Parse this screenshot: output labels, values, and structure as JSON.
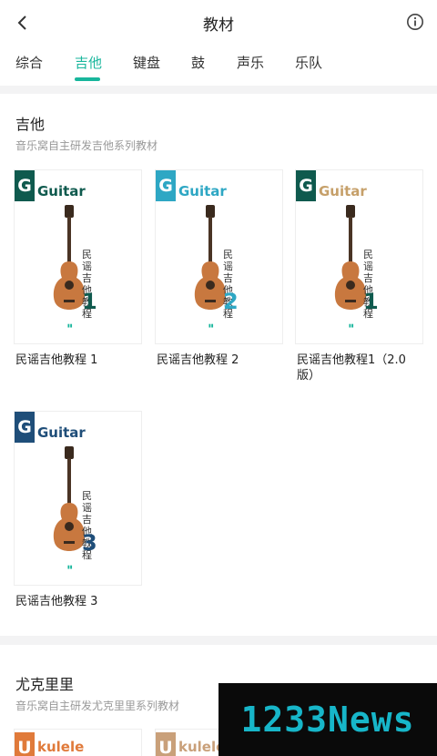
{
  "header": {
    "title": "教材"
  },
  "tabs": [
    "综合",
    "吉他",
    "键盘",
    "鼓",
    "声乐",
    "乐队"
  ],
  "guitar_section": {
    "title": "吉他",
    "subtitle": "音乐窝自主研发吉他系列教材",
    "books": [
      {
        "label": "民谣吉他教程 1",
        "brand": "Guitar",
        "badge": "G",
        "cover_text": "民谣吉他教程",
        "volume": "1",
        "badge_color": "#0f5a4e",
        "brand_color": "#0f5a4e",
        "volume_color": "#0f5a4e"
      },
      {
        "label": "民谣吉他教程 2",
        "brand": "Guitar",
        "badge": "G",
        "cover_text": "民谣吉他教程",
        "volume": "2",
        "badge_color": "#2ea7c4",
        "brand_color": "#2ea7c4",
        "volume_color": "#2ea7c4"
      },
      {
        "label": "民谣吉他教程1（2.0版）",
        "brand": "Guitar",
        "badge": "G",
        "cover_text": "民谣吉他教程",
        "volume": "1",
        "badge_color": "#0f5a4e",
        "brand_color": "#c6a06a",
        "volume_color": "#0f5a4e"
      },
      {
        "label": "民谣吉他教程 3",
        "brand": "Guitar",
        "badge": "G",
        "cover_text": "民谣吉他教程",
        "volume": "3",
        "badge_color": "#1f4e79",
        "brand_color": "#1f4e79",
        "volume_color": "#1f4e79"
      }
    ]
  },
  "ukulele_section": {
    "title": "尤克里里",
    "subtitle": "音乐窝自主研发尤克里里系列教材",
    "books": [
      {
        "brand": "kulele",
        "badge": "U",
        "badge_color": "#e07a3a"
      },
      {
        "brand": "kulele",
        "badge": "U",
        "badge_color": "#c9a07a"
      }
    ]
  },
  "watermark": "1233News",
  "colors": {
    "accent": "#18b69c"
  }
}
